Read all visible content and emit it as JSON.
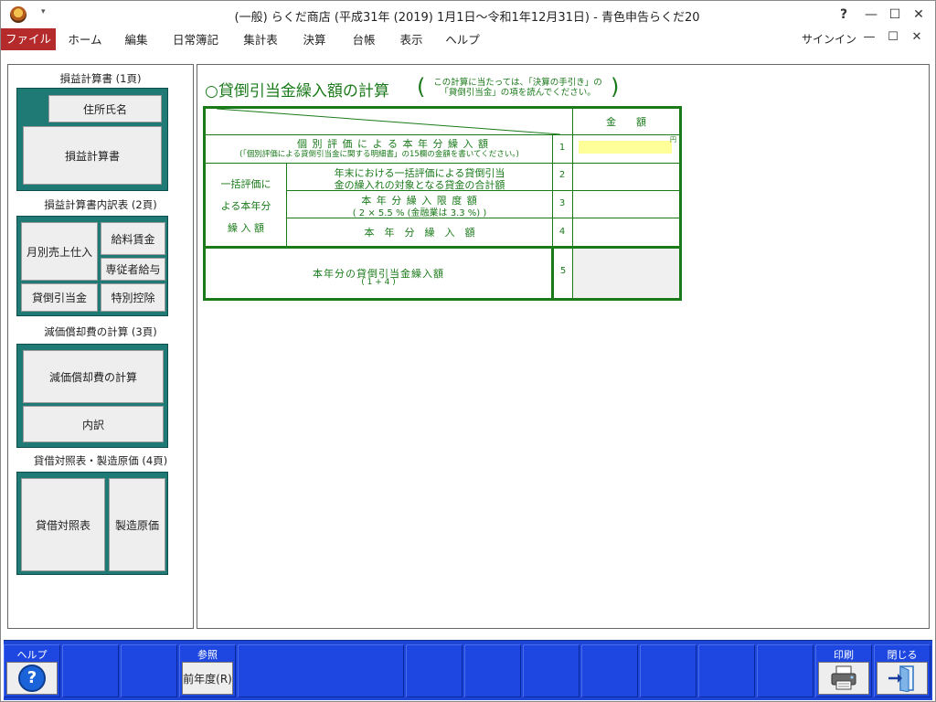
{
  "window": {
    "title": "(一般) らくだ商店 (平成31年 (2019) 1月1日～令和1年12月31日) - 青色申告らくだ20",
    "help_glyph": "?",
    "minimize_glyph": "—",
    "maximize_glyph": "☐",
    "close_glyph": "✕"
  },
  "menu": {
    "file": "ファイル",
    "items": [
      "ホーム",
      "編集",
      "日常簿記",
      "集計表",
      "決算",
      "台帳",
      "表示",
      "ヘルプ"
    ],
    "signin": "サインイン"
  },
  "left": {
    "section1_label": "損益計算書 (1頁)",
    "btn_address": "住所氏名",
    "btn_pl": "損益計算書",
    "section2_label": "損益計算書内訳表 (2頁)",
    "btn_monthly": "月別売上仕入",
    "btn_salary": "給料賃金",
    "btn_family_salary": "専従者給与",
    "btn_bad_debt": "貸倒引当金",
    "btn_special": "特別控除",
    "section3_label": "減価償却費の計算 (3頁)",
    "btn_depr_calc": "減価償却費の計算",
    "btn_breakdown": "内訳",
    "section4_label": "貸借対照表・製造原価 (4頁)",
    "btn_bs": "貸借対照表",
    "btn_cost": "製造原価"
  },
  "calc": {
    "title": "○貸倒引当金繰入額の計算",
    "note_line1": "この計算に当たっては、「決算の手引き」の",
    "note_line2": "「貸倒引当金」の項を読んでください。",
    "amount_header": "金　　額",
    "yen_unit": "円",
    "row1_main": "個 別 評 価 に よ る 本 年 分 繰 入 額",
    "row1_sub": "(「個別評価による貸倒引当金に関する明細書」の15欄の金額を書いてください。)",
    "group_line1": "一括評価に",
    "group_line2": "よる本年分",
    "group_line3": "繰 入 額",
    "row2_line1": "年末における一括評価による貸倒引当",
    "row2_line2": "金の繰入れの対象となる貸金の合計額",
    "row3_line1": "本 年 分 繰 入 限 度 額",
    "row3_line2": "( 2 × 5.5 % (金融業は 3.3 %) )",
    "row4": "本　年　分　繰　入　額",
    "row5_line1": "本年分の貸倒引当金繰入額",
    "row5_line2": "( 1 + 4 )",
    "nums": [
      "1",
      "2",
      "3",
      "4",
      "5"
    ],
    "colors": {
      "green": "#1a7a1a",
      "highlight": "#ffff99",
      "shaded": "#f0f0f0"
    }
  },
  "funcbar": {
    "help_label": "ヘルプ",
    "help_icon": "?",
    "ref_label": "参照",
    "prev_year": "前年度(R)",
    "print_label": "印刷",
    "close_label": "閉じる",
    "accent": "#1e46d6"
  }
}
